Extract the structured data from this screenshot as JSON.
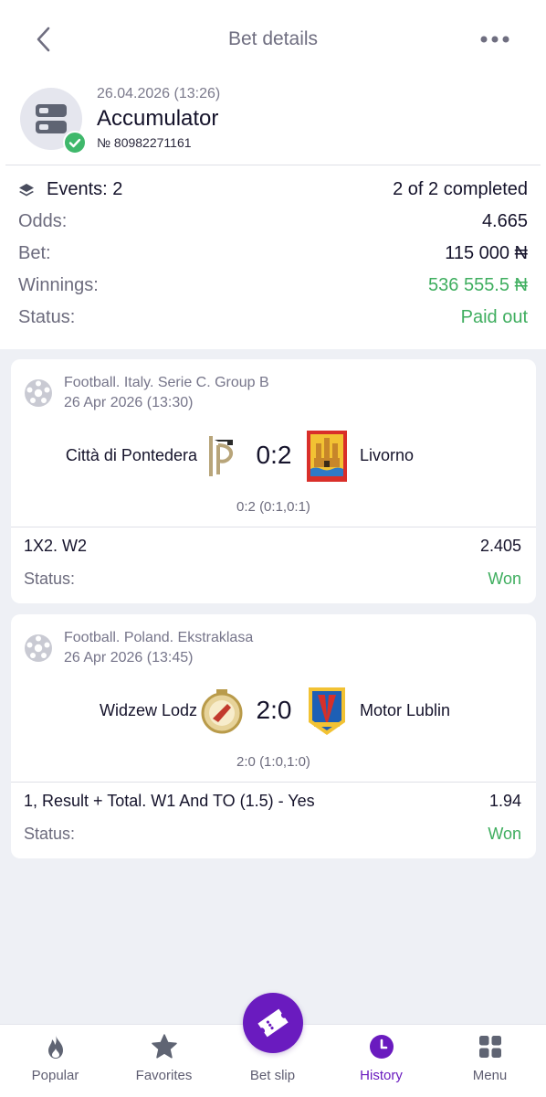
{
  "header": {
    "title": "Bet details"
  },
  "bet": {
    "date": "26.04.2026 (13:26)",
    "type": "Accumulator",
    "number": "№ 80982271161",
    "events_label": "Events: 2",
    "events_completed": "2 of 2 completed",
    "odds_label": "Odds:",
    "odds_value": "4.665",
    "bet_label": "Bet:",
    "bet_value": "115 000 ₦",
    "winnings_label": "Winnings:",
    "winnings_value": "536 555.5 ₦",
    "status_label": "Status:",
    "status_value": "Paid out"
  },
  "events": [
    {
      "league": "Football. Italy. Serie C. Group B",
      "date": "26 Apr 2026 (13:30)",
      "home_team": "Città di Pontedera",
      "away_team": "Livorno",
      "score": "0:2",
      "score_detail": "0:2 (0:1,0:1)",
      "market": "1X2. W2",
      "odd": "2.405",
      "status_label": "Status:",
      "status_value": "Won"
    },
    {
      "league": "Football. Poland. Ekstraklasa",
      "date": "26 Apr 2026 (13:45)",
      "home_team": "Widzew Lodz",
      "away_team": "Motor Lublin",
      "score": "2:0",
      "score_detail": "2:0 (1:0,1:0)",
      "market": "1, Result + Total. W1 And TO (1.5) - Yes",
      "odd": "1.94",
      "status_label": "Status:",
      "status_value": "Won"
    }
  ],
  "nav": {
    "items": [
      {
        "label": "Popular",
        "icon": "flame-icon"
      },
      {
        "label": "Favorites",
        "icon": "star-icon"
      },
      {
        "label": "Bet slip",
        "icon": "ticket-icon"
      },
      {
        "label": "History",
        "icon": "clock-icon",
        "active": true
      },
      {
        "label": "Menu",
        "icon": "grid-icon"
      }
    ]
  },
  "colors": {
    "accent": "#6a1bbf",
    "success": "#3fae5f",
    "background": "#eef0f5"
  }
}
